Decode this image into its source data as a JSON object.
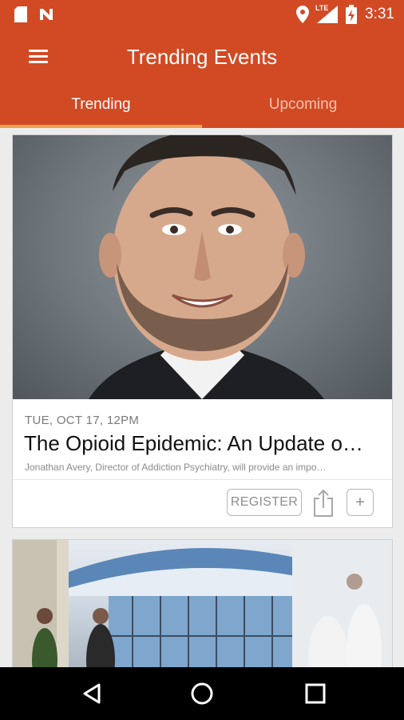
{
  "status_bar": {
    "time": "3:31",
    "network": "LTE",
    "left_icons": [
      "sd-card-icon",
      "n-notification-icon"
    ],
    "right_icons": [
      "location-icon",
      "signal-icon",
      "battery-charging-icon"
    ]
  },
  "app_bar": {
    "title": "Trending Events",
    "menu_icon": "hamburger-menu-icon",
    "color": "#d14a24"
  },
  "tabs": [
    {
      "label": "Trending",
      "active": true
    },
    {
      "label": "Upcoming",
      "active": false
    }
  ],
  "events": [
    {
      "date": "TUE, OCT 17, 12PM",
      "title": "The Opioid Epidemic: An Update o…",
      "description": "Jonathan Avery, Director of Addiction Psychiatry, will provide an impo…",
      "register_label": "REGISTER",
      "add_label": "+"
    }
  ],
  "nav_bar": {
    "buttons": [
      "back-icon",
      "home-icon",
      "recents-icon"
    ]
  }
}
